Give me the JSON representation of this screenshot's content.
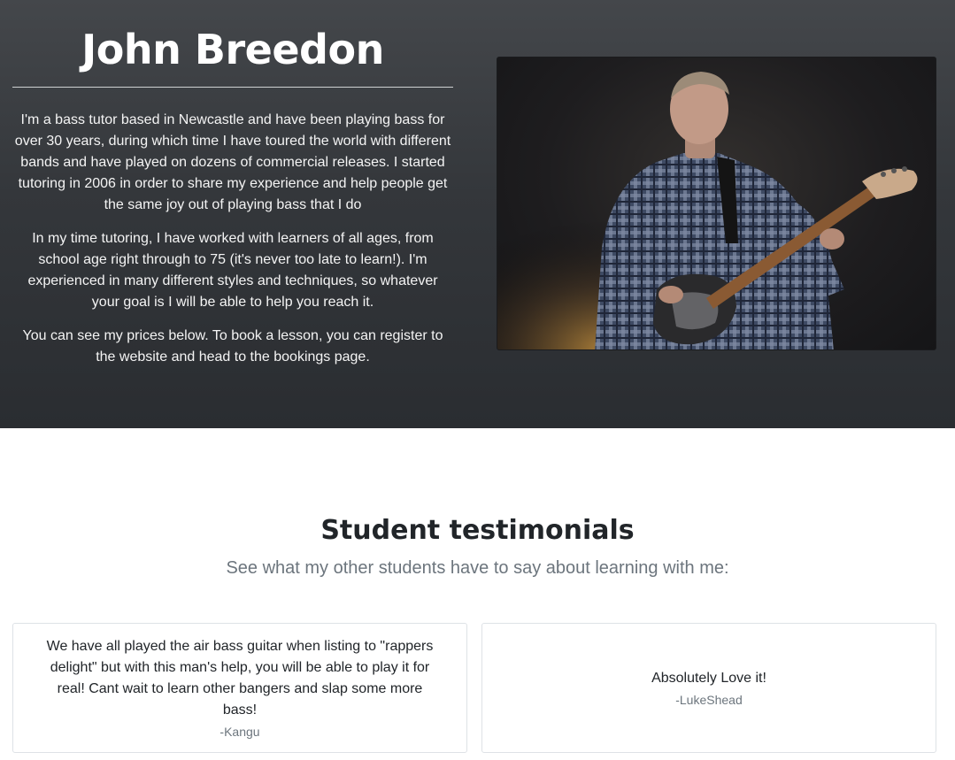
{
  "hero": {
    "title": "John Breedon",
    "paragraphs": [
      "I'm a bass tutor based in Newcastle and have been playing bass for over 30 years, during which time I have toured the world with different bands and have played on dozens of commercial releases. I started tutoring in 2006 in order to share my experience and help people get the same joy out of playing bass that I do",
      "In my time tutoring, I have worked with learners of all ages, from school age right through to 75 (it's never too late to learn!). I'm experienced in many different styles and techniques, so whatever your goal is I will be able to help you reach it.",
      "You can see my prices below. To book a lesson, you can register to the website and head to the bookings page."
    ]
  },
  "testimonials": {
    "title": "Student testimonials",
    "subtitle": "See what my other students have to say about learning with me:",
    "items": [
      {
        "quote": "We have all played the air bass guitar when listing to \"rappers delight\" but with this man's help, you will be able to play it for real! Cant wait to learn other bangers and slap some more bass!",
        "author": "-Kangu"
      },
      {
        "quote": "Absolutely Love it!",
        "author": "-LukeShead"
      }
    ]
  },
  "colors": {
    "hero_bg_top": "#44474b",
    "hero_bg_bottom": "#2a2d31",
    "text_dark": "#212529",
    "text_muted": "#6c757d"
  }
}
